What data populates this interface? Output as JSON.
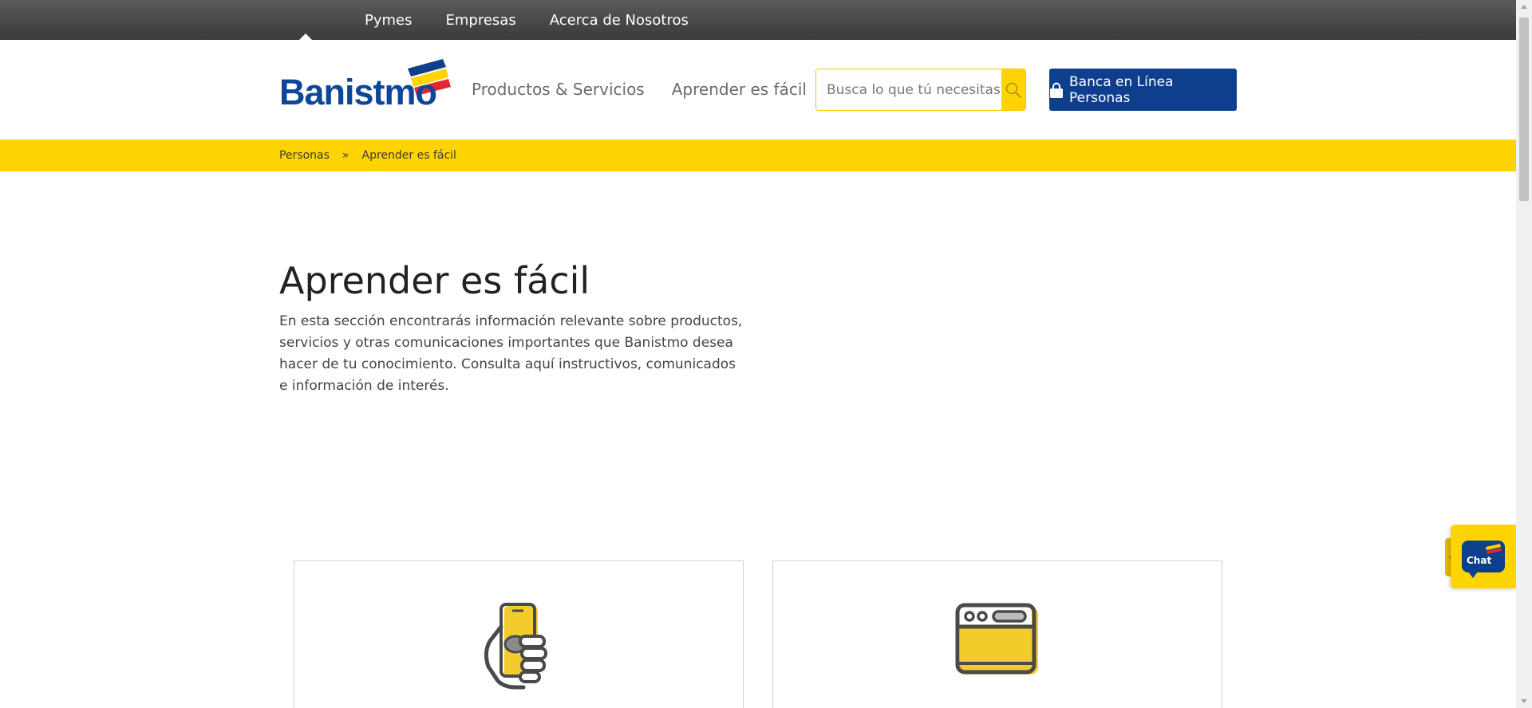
{
  "topnav": {
    "items": [
      {
        "label": "Pymes"
      },
      {
        "label": "Empresas"
      },
      {
        "label": "Acerca de Nosotros"
      }
    ]
  },
  "header": {
    "logo_text": "Banistmo",
    "nav": [
      {
        "label": "Productos & Servicios"
      },
      {
        "label": "Aprender es fácil"
      }
    ],
    "search": {
      "placeholder": "Busca lo que tú necesitas",
      "icon": "search-icon"
    },
    "bank_button": {
      "label": "Banca en Línea Personas",
      "icon": "lock-icon"
    }
  },
  "breadcrumb": {
    "items": [
      "Personas",
      "Aprender es fácil"
    ],
    "separator": "»"
  },
  "main": {
    "title": "Aprender es fácil",
    "intro": "En esta sección encontrarás información relevante sobre productos, servicios y otras comunicaciones importantes que Banistmo desea hacer de tu conocimiento. Consulta aquí instructivos, comunicados e información de interés.",
    "cards": [
      {
        "icon": "hand-holding-phone-icon"
      },
      {
        "icon": "browser-window-icon"
      }
    ]
  },
  "chat": {
    "label": "Chat",
    "toggle": "‹"
  },
  "colors": {
    "brand_blue": "#0d3f8c",
    "brand_yellow": "#ffd400",
    "brand_red": "#e3262f"
  }
}
